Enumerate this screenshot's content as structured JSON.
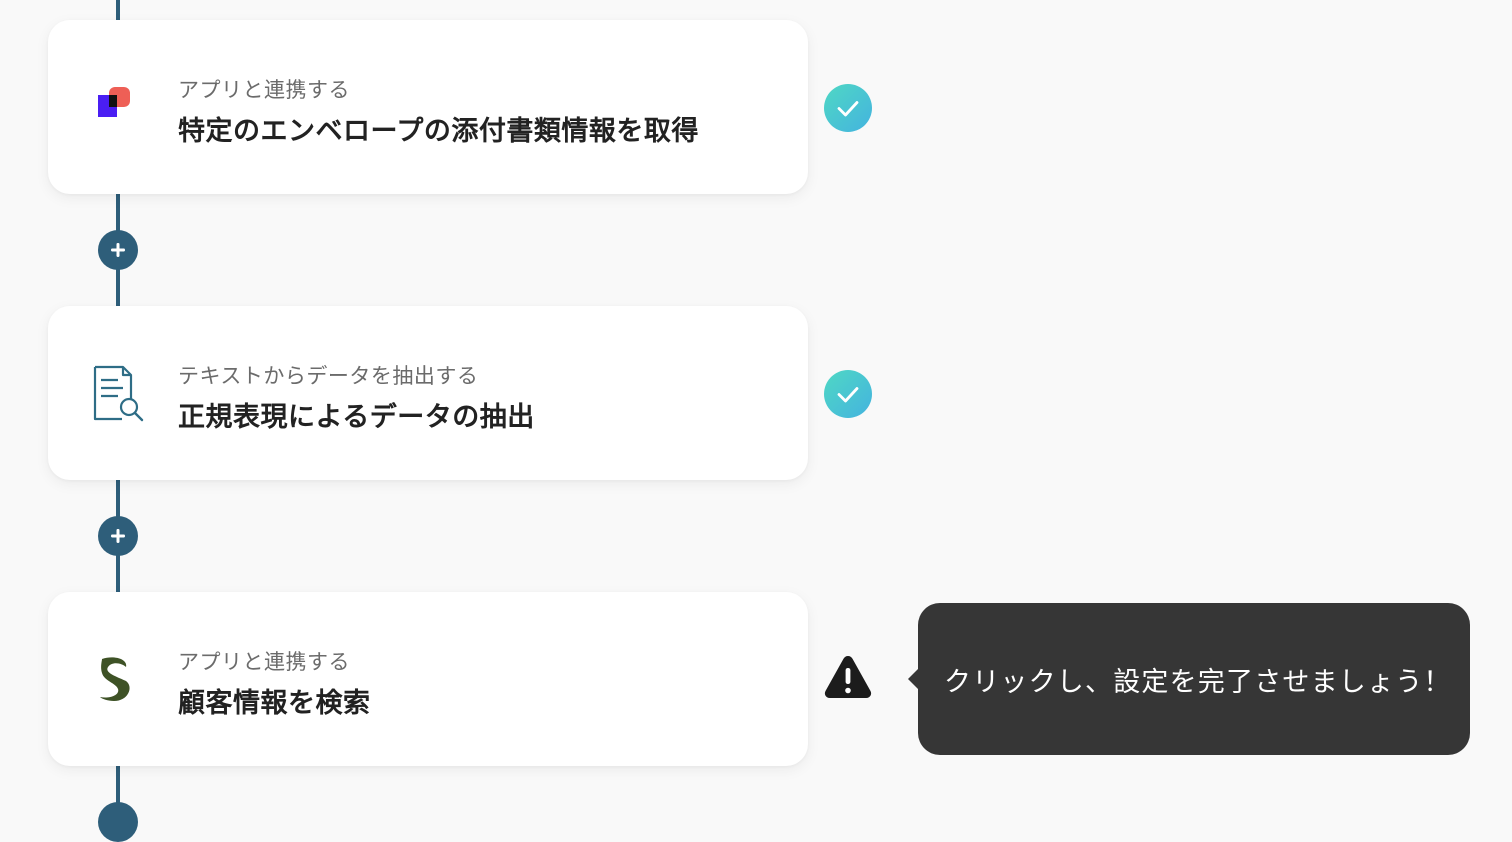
{
  "steps": [
    {
      "subtitle": "アプリと連携する",
      "title": "特定のエンベロープの添付書類情報を取得",
      "icon": "docusign-app-icon",
      "status": "complete"
    },
    {
      "subtitle": "テキストからデータを抽出する",
      "title": "正規表現によるデータの抽出",
      "icon": "document-search-icon",
      "status": "complete"
    },
    {
      "subtitle": "アプリと連携する",
      "title": "顧客情報を検索",
      "icon": "crm-app-icon",
      "status": "incomplete"
    }
  ],
  "tooltip": {
    "text": "クリックし、設定を完了させましょう！"
  },
  "colors": {
    "line": "#2e5e7a",
    "check_gradient_start": "#4fd8c4",
    "check_gradient_end": "#44b3df",
    "warning": "#1c1c1c",
    "tooltip_bg": "#363636"
  }
}
